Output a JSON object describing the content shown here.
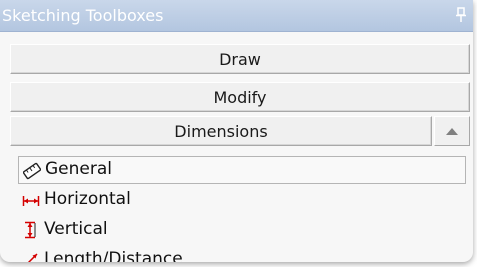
{
  "window": {
    "title": "Sketching Toolboxes"
  },
  "sections": [
    {
      "label": "Draw"
    },
    {
      "label": "Modify"
    },
    {
      "label": "Dimensions"
    }
  ],
  "items": [
    {
      "label": "General",
      "icon": "ruler-icon",
      "selected": true
    },
    {
      "label": "Horizontal",
      "icon": "horizontal-dimension-icon"
    },
    {
      "label": "Vertical",
      "icon": "vertical-dimension-icon"
    },
    {
      "label": "Length/Distance",
      "icon": "length-distance-icon"
    }
  ],
  "colors": {
    "titlebar": "#c4d4ea",
    "dimension_icon": "#d40000"
  }
}
